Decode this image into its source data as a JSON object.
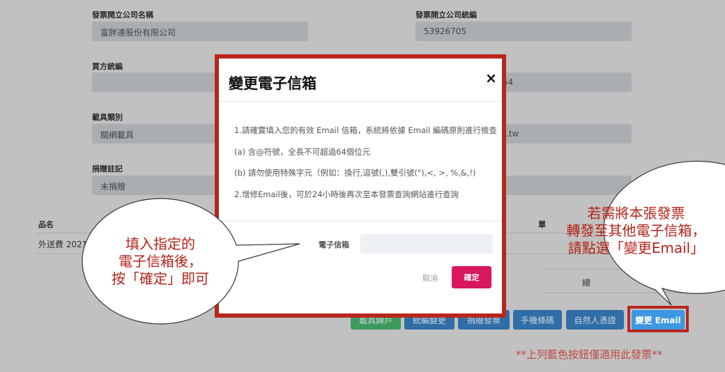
{
  "form": {
    "seller_name_label": "發票開立公司名稱",
    "seller_name_value": "富胖達股份有限公司",
    "seller_id_label": "發票開立公司統編",
    "seller_id_value": "53926705",
    "buyer_id_label": "買方統編",
    "buyer_right_value_partial": "54",
    "carrier_type_label": "載具類別",
    "carrier_type_value": "關網載具",
    "carrier_right_value_partial": ".tw",
    "donation_label": "捐贈註記",
    "donation_value": "未捐贈"
  },
  "table": {
    "header_item": "品名",
    "header_price_partial": "單",
    "row_item_partial": "外送費 2021-0",
    "total_label_partial": "總",
    "total_value_partial": "19"
  },
  "actions": {
    "buttons": [
      {
        "label": "載具歸戶",
        "color": "#3b9a5c"
      },
      {
        "label": "統編變更",
        "color": "#2f6ea6"
      },
      {
        "label": "捐贈發票",
        "color": "#2f6ea6"
      },
      {
        "label": "手機條碼",
        "color": "#2f6ea6"
      },
      {
        "label": "自然人憑證",
        "color": "#2f6ea6"
      },
      {
        "label": "變更 Email",
        "color": "#3d97e3"
      }
    ],
    "note": "**上列藍色按鈕僅適用此發票**"
  },
  "modal": {
    "title": "變更電子信箱",
    "close": "×",
    "lines": [
      "1.請確實填入您的有效 Email 信箱，系統將依據 Email 編碼原則進行檢查",
      "(a) 含@符號，全長不可超過64個位元",
      "(b) 請勿使用特殊字元（例如：換行,逗號(,),雙引號(\"),<, >, %,&,!)",
      "2.增修Email後，可於24小時後再次至本發票查詢網站進行查詢"
    ],
    "email_label": "電子信箱",
    "email_value": "",
    "cancel": "取消",
    "confirm": "確定",
    "confirm_color": "#d8175f"
  },
  "callouts": {
    "left": [
      "填入指定的",
      "電子信箱後，",
      "按「確定」即可"
    ],
    "right": [
      "若需將本張發票",
      "轉發至其他電子信箱，",
      "請點選「變更Email」"
    ]
  }
}
